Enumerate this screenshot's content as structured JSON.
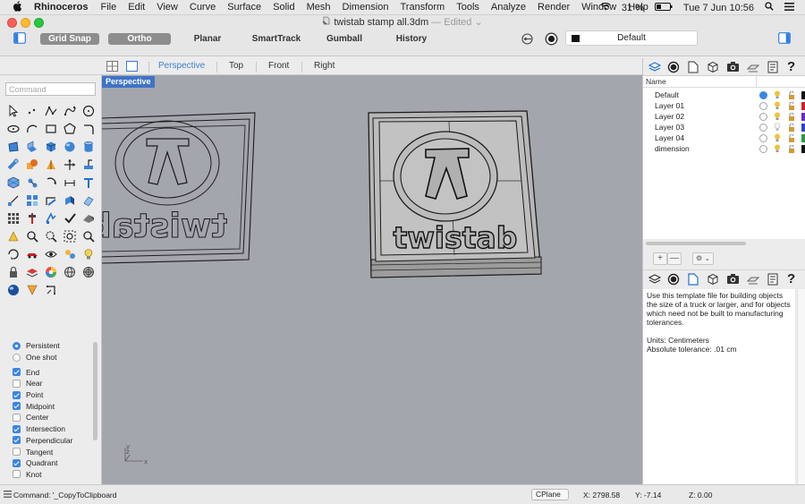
{
  "menubar": {
    "app_name": "Rhinoceros",
    "items": [
      "File",
      "Edit",
      "View",
      "Curve",
      "Surface",
      "Solid",
      "Mesh",
      "Dimension",
      "Transform",
      "Tools",
      "Analyze",
      "Render",
      "Window",
      "Help"
    ],
    "battery": "31 %",
    "datetime": "Tue 7 Jun  10:56"
  },
  "window": {
    "title": "twistab stamp all.3dm",
    "edited": "— Edited ⌄"
  },
  "toolbar": {
    "grid_snap": "Grid Snap",
    "ortho": "Ortho",
    "planar": "Planar",
    "smarttrack": "SmartTrack",
    "gumball": "Gumball",
    "history": "History",
    "current_layer": "Default"
  },
  "viewport_tabs": [
    "Perspective",
    "Top",
    "Front",
    "Right"
  ],
  "viewport": {
    "label": "Perspective",
    "model_text": "twistab",
    "mirrored_text": "twistab",
    "axis_y": "y",
    "axis_z": "z",
    "axis_x": "x"
  },
  "command": {
    "placeholder": "Command"
  },
  "osnaps": {
    "mode": [
      {
        "label": "Persistent",
        "checked": true
      },
      {
        "label": "One shot",
        "checked": false
      }
    ],
    "items": [
      {
        "label": "End",
        "checked": true
      },
      {
        "label": "Near",
        "checked": false
      },
      {
        "label": "Point",
        "checked": true
      },
      {
        "label": "Midpoint",
        "checked": true
      },
      {
        "label": "Center",
        "checked": false
      },
      {
        "label": "Intersection",
        "checked": true
      },
      {
        "label": "Perpendicular",
        "checked": true
      },
      {
        "label": "Tangent",
        "checked": false
      },
      {
        "label": "Quadrant",
        "checked": true
      },
      {
        "label": "Knot",
        "checked": false
      }
    ]
  },
  "layers": {
    "header": "Name",
    "rows": [
      {
        "name": "Default",
        "current": true,
        "color": "#111111"
      },
      {
        "name": "Layer 01",
        "current": false,
        "color": "#d0212a"
      },
      {
        "name": "Layer 02",
        "current": false,
        "color": "#6a2cbf"
      },
      {
        "name": "Layer 03",
        "current": false,
        "color": "#2a46c9"
      },
      {
        "name": "Layer 04",
        "current": false,
        "color": "#2a9b3c"
      },
      {
        "name": "dimension",
        "current": false,
        "color": "#111111"
      }
    ],
    "add_label": "+",
    "remove_label": "—",
    "gear_label": "⚙ ⌄"
  },
  "notes": {
    "p1": "Use this template file for building objects the size of a truck or larger, and for objects which need not be built to manufacturing tolerances.",
    "p2": "Units: Centimeters",
    "p3": "Absolute tolerance: .01 cm"
  },
  "status": {
    "command": "Command: '_CopyToClipboard",
    "cplane": "CPlane ⌄",
    "x": "X: 2798.58",
    "y": "Y: -7.14",
    "z": "Z: 0.00"
  },
  "colors": {
    "accent": "#3c86e3",
    "viewport_bg": "#a4a6ae",
    "viewport_label_bg": "#3f73c7"
  }
}
